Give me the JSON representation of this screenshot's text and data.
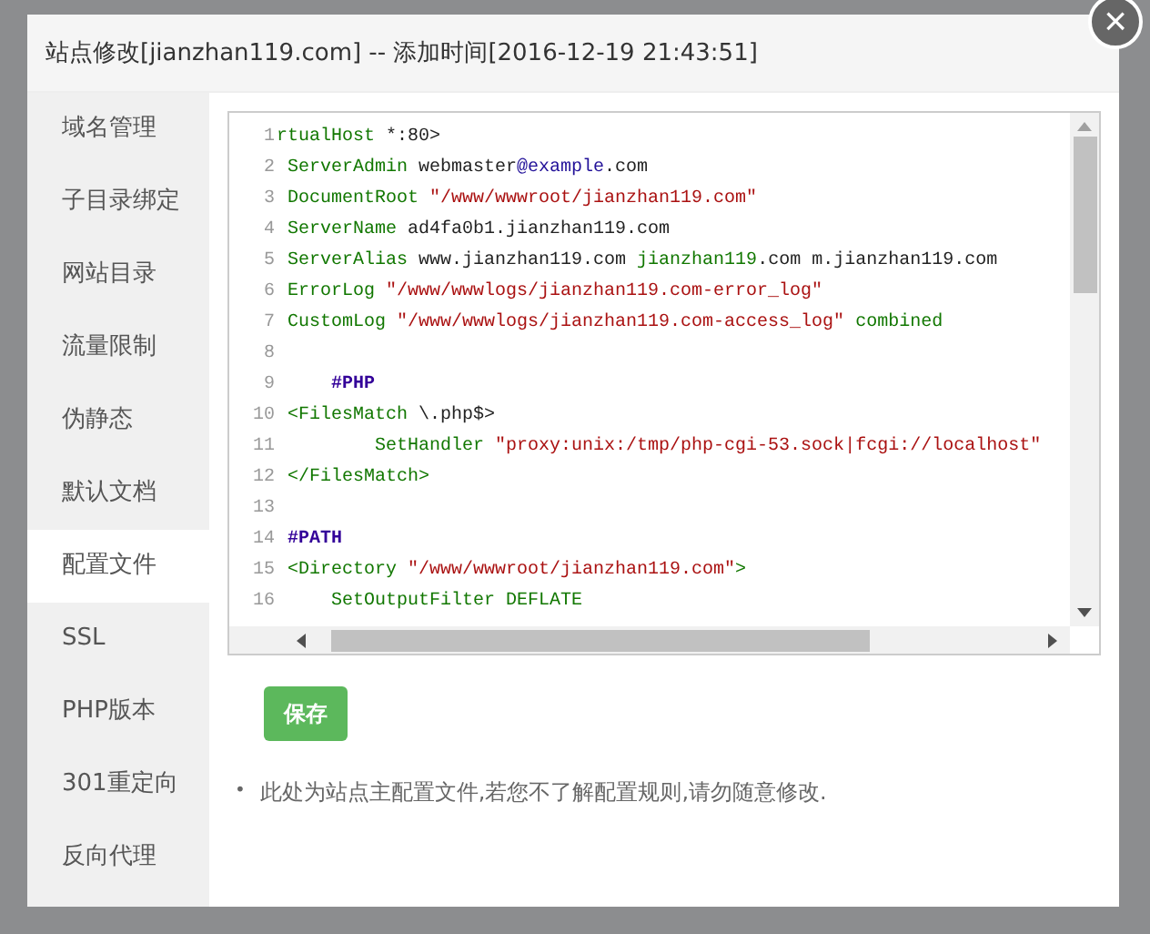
{
  "dialog": {
    "title": "站点修改[jianzhan119.com] -- 添加时间[2016-12-19 21:43:51]",
    "close_icon": "×"
  },
  "sidebar": {
    "items": [
      {
        "label": "域名管理",
        "selected": false
      },
      {
        "label": "子目录绑定",
        "selected": false
      },
      {
        "label": "网站目录",
        "selected": false
      },
      {
        "label": "流量限制",
        "selected": false
      },
      {
        "label": "伪静态",
        "selected": false
      },
      {
        "label": "默认文档",
        "selected": false
      },
      {
        "label": "配置文件",
        "selected": true
      },
      {
        "label": "SSL",
        "selected": false
      },
      {
        "label": "PHP版本",
        "selected": false
      },
      {
        "label": "301重定向",
        "selected": false
      },
      {
        "label": "反向代理",
        "selected": false
      }
    ]
  },
  "editor": {
    "lines": [
      {
        "number": "1",
        "tokens": [
          {
            "kind": "tag",
            "text": "rtualHost "
          },
          {
            "kind": "plain",
            "text": "*:80>"
          }
        ]
      },
      {
        "number": "2",
        "tokens": [
          {
            "kind": "keyword",
            "text": " ServerAdmin "
          },
          {
            "kind": "plain",
            "text": "webmaster"
          },
          {
            "kind": "atom",
            "text": "@example"
          },
          {
            "kind": "plain",
            "text": ".com"
          }
        ]
      },
      {
        "number": "3",
        "tokens": [
          {
            "kind": "keyword",
            "text": " DocumentRoot "
          },
          {
            "kind": "string",
            "text": "\"/www/wwwroot/jianzhan119.com\""
          }
        ]
      },
      {
        "number": "4",
        "tokens": [
          {
            "kind": "keyword",
            "text": " ServerName "
          },
          {
            "kind": "plain",
            "text": "ad4fa0b1.jianzhan119.com"
          }
        ]
      },
      {
        "number": "5",
        "tokens": [
          {
            "kind": "keyword",
            "text": " ServerAlias "
          },
          {
            "kind": "plain",
            "text": "www.jianzhan119.com "
          },
          {
            "kind": "keyword",
            "text": "jianzhan119"
          },
          {
            "kind": "plain",
            "text": ".com m.jianzhan119.com"
          }
        ]
      },
      {
        "number": "6",
        "tokens": [
          {
            "kind": "keyword",
            "text": " ErrorLog "
          },
          {
            "kind": "string",
            "text": "\"/www/wwwlogs/jianzhan119.com-error_log\""
          }
        ]
      },
      {
        "number": "7",
        "tokens": [
          {
            "kind": "keyword",
            "text": " CustomLog "
          },
          {
            "kind": "string",
            "text": "\"/www/wwwlogs/jianzhan119.com-access_log\""
          },
          {
            "kind": "keyword",
            "text": " combined"
          }
        ]
      },
      {
        "number": "8"
      },
      {
        "number": "9",
        "tokens": [
          {
            "kind": "comment",
            "text": "     #PHP"
          }
        ]
      },
      {
        "number": "10",
        "tokens": [
          {
            "kind": "tag",
            "text": " <FilesMatch "
          },
          {
            "kind": "plain",
            "text": "\\.php$>"
          }
        ]
      },
      {
        "number": "11",
        "tokens": [
          {
            "kind": "keyword",
            "text": "         SetHandler "
          },
          {
            "kind": "string",
            "text": "\"proxy:unix:/tmp/php-cgi-53.sock|fcgi://localhost\""
          }
        ]
      },
      {
        "number": "12",
        "tokens": [
          {
            "kind": "tag",
            "text": " </FilesMatch>"
          }
        ]
      },
      {
        "number": "13"
      },
      {
        "number": "14",
        "tokens": [
          {
            "kind": "comment",
            "text": " #PATH"
          }
        ]
      },
      {
        "number": "15",
        "tokens": [
          {
            "kind": "tag",
            "text": " <Directory "
          },
          {
            "kind": "string",
            "text": "\"/www/wwwroot/jianzhan119.com\""
          },
          {
            "kind": "tag",
            "text": ">"
          }
        ]
      },
      {
        "number": "16",
        "tokens": [
          {
            "kind": "keyword",
            "text": "     SetOutputFilter DEFLATE"
          }
        ]
      }
    ]
  },
  "save_button": "保存",
  "notes": [
    {
      "marker": "•",
      "text": "此处为站点主配置文件,若您不了解配置规则,请勿随意修改."
    }
  ]
}
